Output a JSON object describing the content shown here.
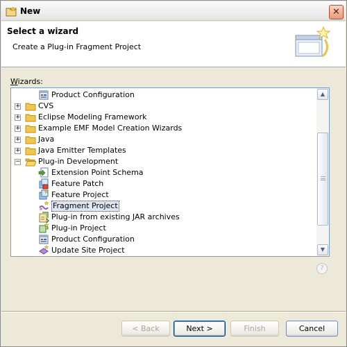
{
  "window": {
    "title": "New",
    "close_glyph": "✕"
  },
  "header": {
    "title": "Select a wizard",
    "subtitle": "Create a Plug-in Fragment Project"
  },
  "wizards_label": {
    "accel": "W",
    "rest": "izards:"
  },
  "tree": {
    "items": [
      {
        "label": "Product Configuration",
        "icon": "product-config-icon",
        "level": 1,
        "expander": ""
      },
      {
        "label": "CVS",
        "icon": "folder-icon",
        "level": 0,
        "expander": "+"
      },
      {
        "label": "Eclipse Modeling Framework",
        "icon": "folder-icon",
        "level": 0,
        "expander": "+"
      },
      {
        "label": "Example EMF Model Creation Wizards",
        "icon": "folder-icon",
        "level": 0,
        "expander": "+"
      },
      {
        "label": "Java",
        "icon": "folder-icon",
        "level": 0,
        "expander": "+"
      },
      {
        "label": "Java Emitter Templates",
        "icon": "folder-icon",
        "level": 0,
        "expander": "+"
      },
      {
        "label": "Plug-in Development",
        "icon": "open-folder-icon",
        "level": 0,
        "expander": "−"
      },
      {
        "label": "Extension Point Schema",
        "icon": "schema-icon",
        "level": 1,
        "expander": ""
      },
      {
        "label": "Feature Patch",
        "icon": "feature-patch-icon",
        "level": 1,
        "expander": ""
      },
      {
        "label": "Feature Project",
        "icon": "feature-project-icon",
        "level": 1,
        "expander": ""
      },
      {
        "label": "Fragment Project",
        "icon": "fragment-project-icon",
        "level": 1,
        "expander": "",
        "selected": true
      },
      {
        "label": "Plug-in from existing JAR archives",
        "icon": "plugin-jar-icon",
        "level": 1,
        "expander": ""
      },
      {
        "label": "Plug-in Project",
        "icon": "plugin-project-icon",
        "level": 1,
        "expander": ""
      },
      {
        "label": "Product Configuration",
        "icon": "product-config-icon",
        "level": 1,
        "expander": ""
      },
      {
        "label": "Update Site Project",
        "icon": "update-site-icon",
        "level": 1,
        "expander": ""
      }
    ]
  },
  "scrollbar": {
    "up_glyph": "▲",
    "down_glyph": "▼"
  },
  "help": {
    "glyph": "?"
  },
  "buttons": {
    "back": "< Back",
    "next": "Next >",
    "finish": "Finish",
    "cancel": "Cancel"
  },
  "colors": {
    "dialog_bg": "#ece9d8",
    "selection_bg": "#dfe6f2",
    "folder_yellow": "#f3c64e"
  }
}
